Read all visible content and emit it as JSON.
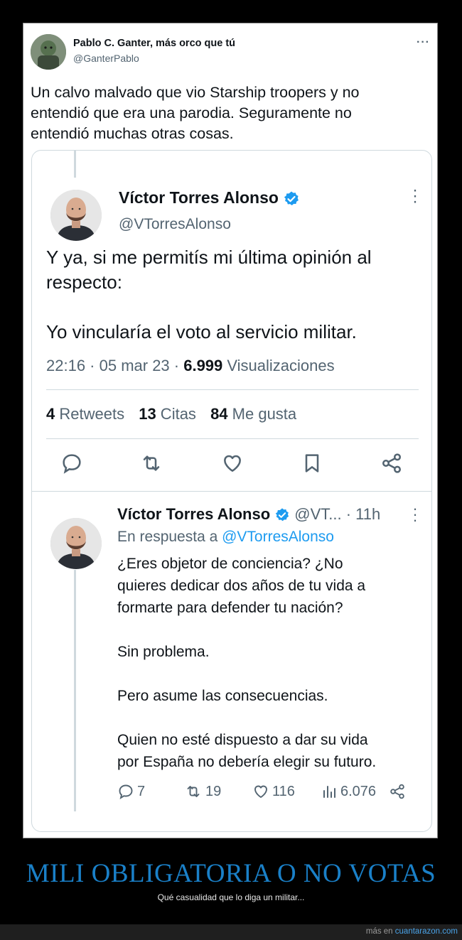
{
  "outer_tweet": {
    "name": "Pablo C. Ganter, más orco que tú",
    "handle": "@GanterPablo",
    "more": "···",
    "text": "Un calvo malvado que vio Starship troopers y no\nentendió que era una parodia. Seguramente no\nentendió muchas otras cosas."
  },
  "quoted_tweet": {
    "name": "Víctor Torres Alonso",
    "handle": "@VTorresAlonso",
    "text": "Y ya, si me permitís mi última opinión al\nrespecto:\n\nYo vincularía el voto al servicio militar.",
    "time": "22:16 · 05 mar 23 · ",
    "views_count": "6.999",
    "views_label": " Visualizaciones",
    "retweets_count": "4",
    "retweets_label": " Retweets",
    "quotes_count": "13",
    "quotes_label": " Citas",
    "likes_count": "84",
    "likes_label": " Me gusta",
    "actions": [
      "reply-icon",
      "retweet-icon",
      "like-icon",
      "bookmark-icon",
      "share-icon"
    ]
  },
  "reply_tweet": {
    "name": "Víctor Torres Alonso",
    "handle_time": " @VT...  · 11h",
    "reply_prefix": "En respuesta a ",
    "reply_to": "@VTorresAlonso",
    "text": "¿Eres objetor de conciencia? ¿No\nquieres dedicar dos años de tu vida a\nformarte para defender tu nación?\n\nSin problema.\n\nPero asume las consecuencias.\n\nQuien no esté dispuesto a dar su vida\npor España no debería elegir su futuro.",
    "replies": "7",
    "retweets": "19",
    "likes": "116",
    "views": "6.076"
  },
  "caption": {
    "title": "MILI OBLIGATORIA O NO VOTAS",
    "subtitle": "Qué casualidad que lo diga un militar..."
  },
  "footer": {
    "prefix": "más en ",
    "link": "cuantarazon.com"
  },
  "colors": {
    "accent": "#1d9bf0",
    "caption_blue": "#1a80c8",
    "text": "#0f1419",
    "muted": "#536471"
  }
}
